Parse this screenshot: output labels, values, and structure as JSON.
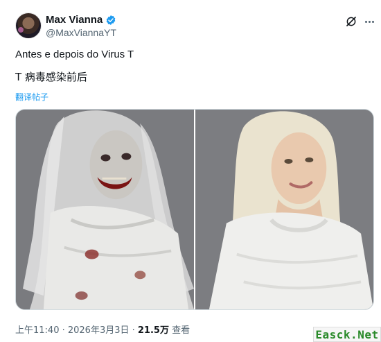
{
  "author": {
    "display_name": "Max Vianna",
    "handle": "@MaxViannaYT",
    "verified_color": "#1d9bf0"
  },
  "header_actions": {
    "grok_icon": "grok-icon",
    "more_icon": "more-icon"
  },
  "post": {
    "line1": "Antes e depois do Virus T",
    "line2": "T 病毒感染前后",
    "translate_label": "翻译帖子"
  },
  "media": {
    "image_left": "zombie-woman-before",
    "image_right": "woman-after"
  },
  "meta": {
    "time_date": "上午11:40 · 2026年3月3日 · ",
    "views_count": "21.5万",
    "views_label": " 查看"
  },
  "watermark": {
    "text": "Easck.Net"
  },
  "colors": {
    "accent": "#1d9bf0",
    "text_secondary": "#536471",
    "photo_bg": "#7b7c80"
  }
}
